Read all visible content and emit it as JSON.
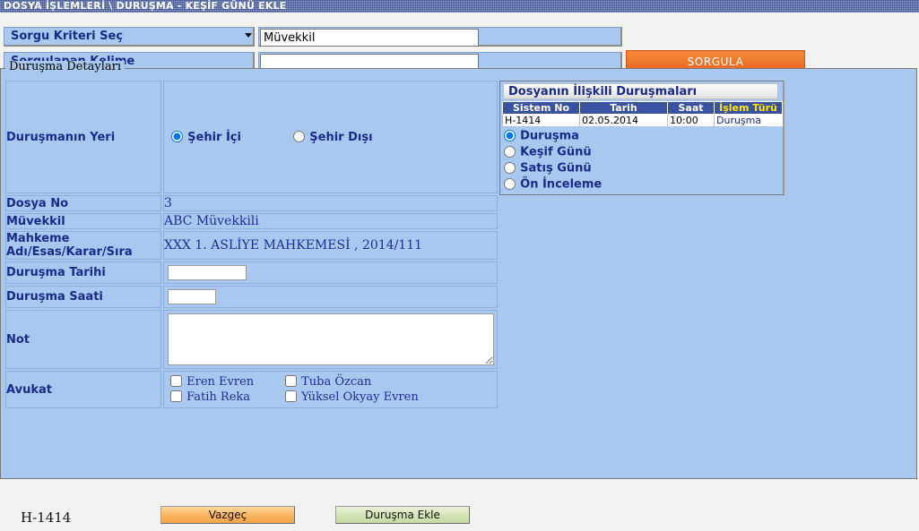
{
  "window": {
    "title": "DOSYA İŞLEMLERİ \\ DURUŞMA  -  KEŞİF GÜNÜ EKLE"
  },
  "search": {
    "criteria_label": "Sorgu Kriteri Seç",
    "criteria_value": "Müvekkil",
    "criteria_options": [
      "Müvekkil"
    ],
    "keyword_label": "Sorgulanan Kelime",
    "keyword_value": "",
    "keyword_placeholder": "",
    "submit_label": "SORGULA"
  },
  "panel": {
    "legend": "Duruşma Detayları"
  },
  "form": {
    "place_label": "Duruşmanın Yeri",
    "place_options": [
      {
        "label": "Şehir İçi",
        "checked": true
      },
      {
        "label": "Şehir Dışı",
        "checked": false
      }
    ],
    "file_no_label": "Dosya No",
    "file_no_value": "3",
    "client_label": "Müvekkil",
    "client_value": "ABC Müvekkili",
    "court_label": "Mahkeme Adı/Esas/Karar/Sıra",
    "court_value": "XXX 1. ASLİYE MAHKEMESİ , 2014/111",
    "hearing_date_label": "Duruşma Tarihi",
    "hearing_date_value": "",
    "hearing_time_label": "Duruşma Saati",
    "hearing_time_value": "",
    "note_label": "Not",
    "note_value": "",
    "lawyer_label": "Avukat",
    "lawyers": [
      {
        "label": "Eren Evren",
        "checked": false
      },
      {
        "label": "Tuba Özcan",
        "checked": false
      },
      {
        "label": "Fatih Reka",
        "checked": false
      },
      {
        "label": "Yüksel Okyay Evren",
        "checked": false
      }
    ]
  },
  "footer": {
    "case_id": "H-1414",
    "cancel_label": "Vazgeç",
    "add_label": "Duruşma Ekle"
  },
  "related": {
    "title": "Dosyanın İlişkili Duruşmaları",
    "columns": [
      "Sistem No",
      "Tarih",
      "Saat",
      "İşlem Türü"
    ],
    "rows": [
      {
        "sistem_no": "H-1414",
        "tarih": "02.05.2014",
        "saat": "10:00",
        "islem_turu": "Duruşma"
      }
    ],
    "type_options": [
      {
        "label": "Duruşma",
        "checked": true
      },
      {
        "label": "Keşif Günü",
        "checked": false
      },
      {
        "label": "Satış Günü",
        "checked": false
      },
      {
        "label": "Ön İnceleme",
        "checked": false
      }
    ]
  },
  "colors": {
    "titlebar": "#3a51a0",
    "panel_bg": "#a8c8f0",
    "label_text": "#1b2a8a",
    "accent_orange": "#ef7b2e",
    "accent_green": "#d3e4b4",
    "table_header_accent": "#ffe600"
  }
}
